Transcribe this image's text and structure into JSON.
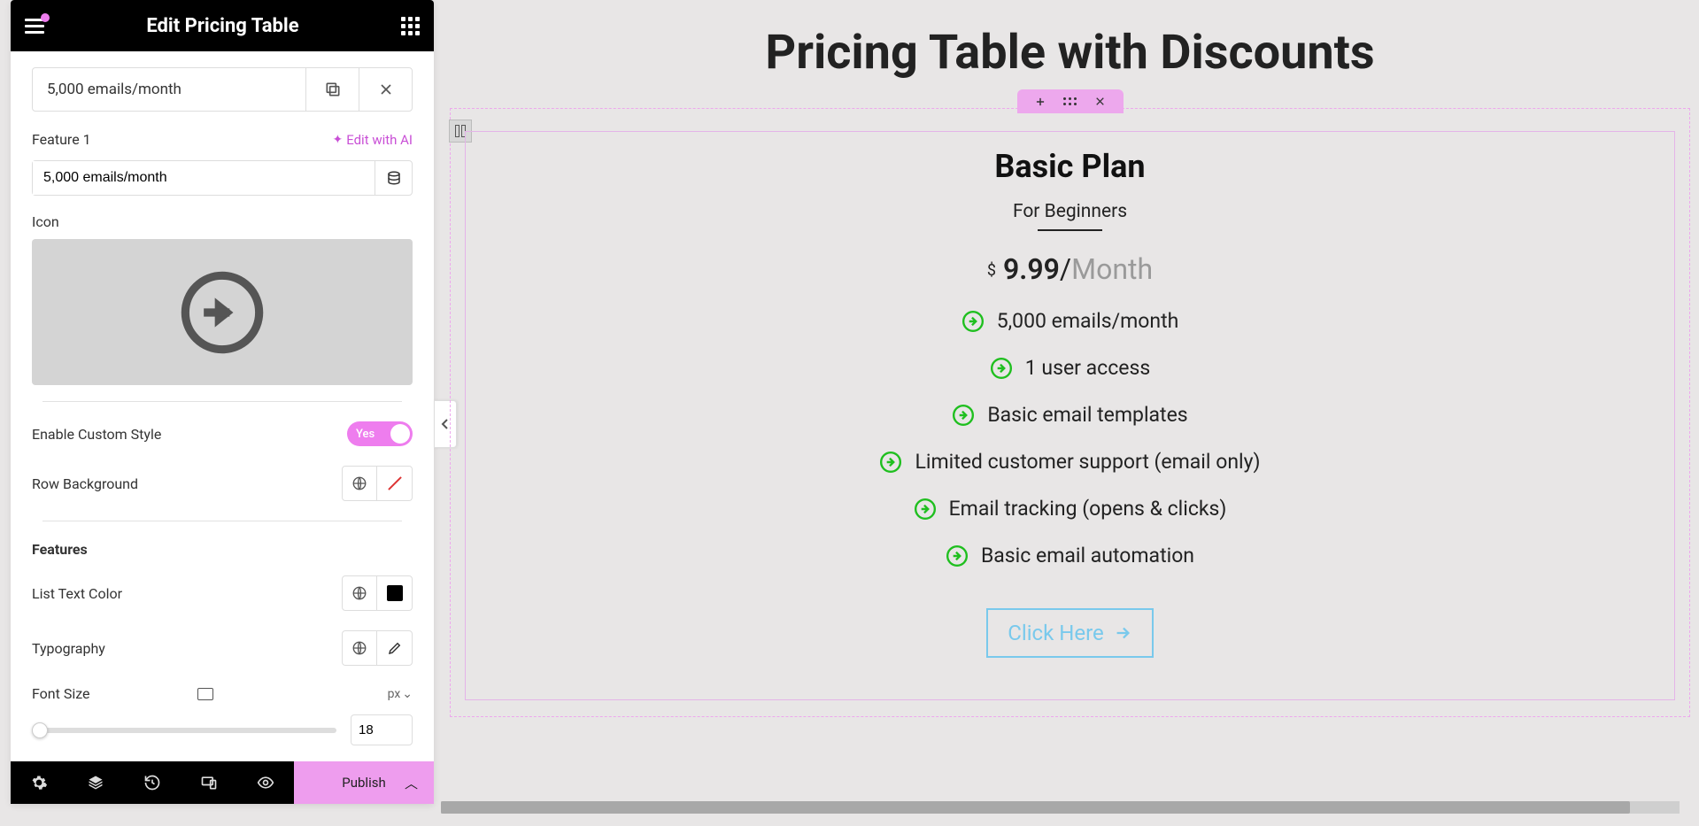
{
  "sidebar": {
    "title": "Edit Pricing Table",
    "item_title": "5,000 emails/month",
    "feature_label": "Feature 1",
    "edit_ai": "Edit with AI",
    "feature_value": "5,000 emails/month",
    "icon_label": "Icon",
    "enable_custom_style": "Enable Custom Style",
    "toggle_yes": "Yes",
    "row_background": "Row Background",
    "features_section": "Features",
    "list_text_color": "List Text Color",
    "typography": "Typography",
    "font_size": "Font Size",
    "font_size_unit": "px",
    "font_size_value": "18"
  },
  "bottombar": {
    "publish": "Publish"
  },
  "canvas": {
    "title": "Pricing Table with Discounts",
    "plan_title": "Basic Plan",
    "plan_subtitle": "For Beginners",
    "currency": "$",
    "price": "9.99",
    "separator": "/",
    "period": "Month",
    "features": [
      "5,000 emails/month",
      "1 user access",
      "Basic email templates",
      "Limited customer support (email only)",
      "Email tracking (opens & clicks)",
      "Basic email automation"
    ],
    "cta": "Click Here"
  }
}
